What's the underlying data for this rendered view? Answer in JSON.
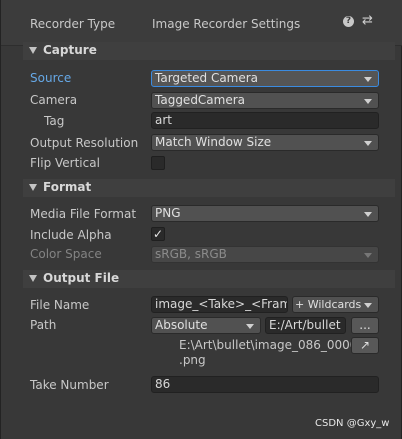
{
  "header": {
    "recorder_type_label": "Recorder Type",
    "recorder_type_value": "Image Recorder Settings",
    "help_icon": "?",
    "settings_icon": "⇄"
  },
  "capture": {
    "title": "Capture",
    "source_label": "Source",
    "source_value": "Targeted Camera",
    "camera_label": "Camera",
    "camera_value": "TaggedCamera",
    "tag_label": "Tag",
    "tag_value": "art",
    "output_resolution_label": "Output Resolution",
    "output_resolution_value": "Match Window Size",
    "flip_vertical_label": "Flip Vertical"
  },
  "format": {
    "title": "Format",
    "media_file_format_label": "Media File Format",
    "media_file_format_value": "PNG",
    "include_alpha_label": "Include Alpha",
    "include_alpha_check": "✓",
    "color_space_label": "Color Space",
    "color_space_value": "sRGB, sRGB"
  },
  "output_file": {
    "title": "Output File",
    "file_name_label": "File Name",
    "file_name_value": "image_<Take>_<Frame>",
    "wildcards_label": "+ Wildcards",
    "path_label": "Path",
    "path_type_value": "Absolute",
    "path_value": "E:/Art/bullet",
    "browse_label": "...",
    "resolved_path_line1": "E:\\Art\\bullet\\image_086_0000",
    "resolved_path_line2": ".png",
    "open_folder_icon": "↗",
    "take_number_label": "Take Number",
    "take_number_value": "86"
  },
  "watermark": "CSDN @Gxy_w"
}
